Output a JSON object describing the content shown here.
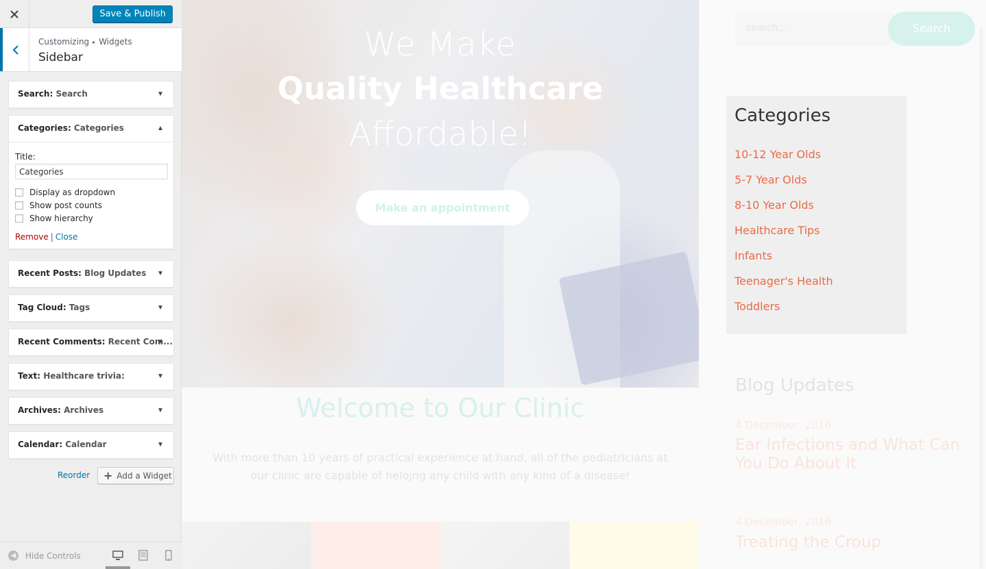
{
  "customizer": {
    "save_label": "Save & Publish",
    "breadcrumb": {
      "root": "Customizing",
      "section": "Widgets"
    },
    "section_title": "Sidebar",
    "widgets": [
      {
        "type": "Search",
        "title": "Search"
      },
      {
        "type": "Categories",
        "title": "Categories",
        "expanded": true
      },
      {
        "type": "Recent Posts",
        "title": "Blog Updates"
      },
      {
        "type": "Tag Cloud",
        "title": "Tags"
      },
      {
        "type": "Recent Comments",
        "title": "Recent Com..."
      },
      {
        "type": "Text",
        "title": "Healthcare trivia:"
      },
      {
        "type": "Archives",
        "title": "Archives"
      },
      {
        "type": "Calendar",
        "title": "Calendar"
      }
    ],
    "categories_form": {
      "title_label": "Title:",
      "title_value": "Categories",
      "options": [
        {
          "label": "Display as dropdown",
          "checked": false
        },
        {
          "label": "Show post counts",
          "checked": false
        },
        {
          "label": "Show hierarchy",
          "checked": false
        }
      ],
      "remove_label": "Remove",
      "separator": "|",
      "close_label": "Close"
    },
    "reorder_label": "Reorder",
    "add_widget_label": "Add a Widget",
    "hide_controls_label": "Hide Controls",
    "active_device": "desktop"
  },
  "preview": {
    "hero": {
      "line1": "We Make",
      "line2": "Quality Healthcare",
      "line3": "Affordable!",
      "cta": "Make an appointment"
    },
    "welcome": {
      "title": "Welcome to Our Clinic",
      "text": "With more than 10 years of practical experience at hand, all of the pediatricians at our clinic are capable of helojng any child with any kind of a disease!"
    },
    "search": {
      "placeholder": "search...",
      "button": "Search"
    },
    "categories": {
      "title": "Categories",
      "items": [
        "10-12 Year Olds",
        "5-7 Year Olds",
        "8-10 Year Olds",
        "Healthcare Tips",
        "Infants",
        "Teenager's Health",
        "Toddlers"
      ]
    },
    "blog": {
      "title": "Blog Updates",
      "posts": [
        {
          "date": "4 December, 2016",
          "title": "Ear Infections and What Can You Do About It"
        },
        {
          "date": "4 December, 2016",
          "title": "Treating the Croup"
        }
      ]
    }
  },
  "colors": {
    "accent_blue": "#0085ba",
    "link_blue": "#0073aa",
    "remove_red": "#aa0000",
    "category_orange": "#e96b47",
    "mint": "#d7f2ed"
  }
}
